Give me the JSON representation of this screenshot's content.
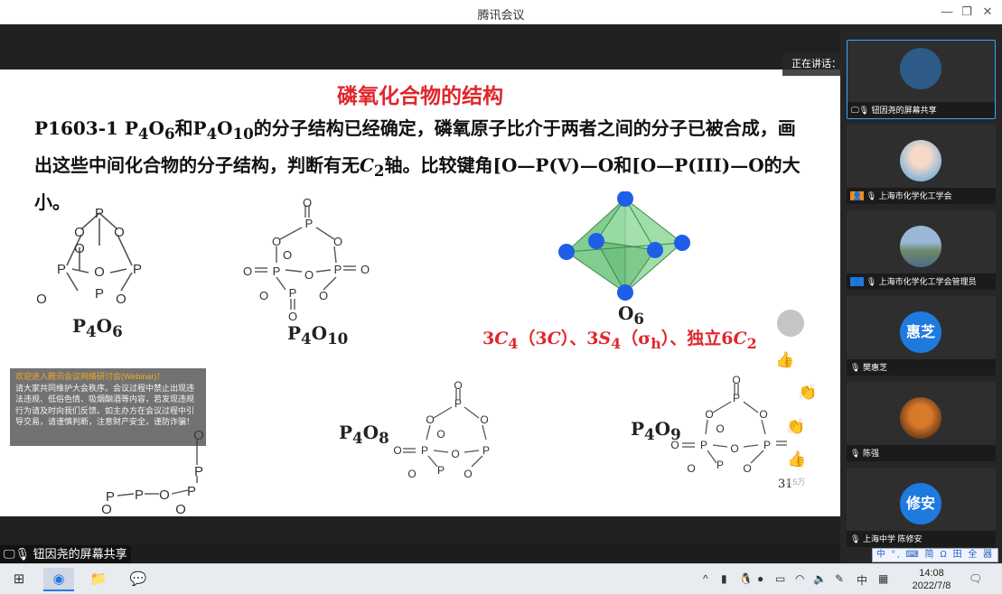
{
  "window": {
    "title": "腾讯会议"
  },
  "slide": {
    "title": "磷氧化合物的结构",
    "problem_parts": [
      "P1603-1 P",
      "4",
      "O",
      "6",
      "和P",
      "4",
      "O",
      "10",
      "的分子结构已经确定，磷氧原子比介于两者之间的分子已被合成，画出这些中间化合物的分子结构，判断有无",
      "C",
      "2",
      "轴。比较键角[O—P(V)—O和[O—P(III)—O的大小。"
    ],
    "formulas": {
      "p4o6": [
        "P",
        "4",
        "O",
        "6"
      ],
      "p4o10": [
        "P",
        "4",
        "O",
        "10"
      ],
      "p4o8": [
        "P",
        "4",
        "O",
        "8"
      ],
      "p4o9": [
        "P",
        "4",
        "O",
        "9"
      ],
      "o6": [
        "O",
        "6"
      ]
    },
    "atom_labels": {
      "phosphorus": "P",
      "oxygen": "O"
    },
    "symmetry_parts": [
      "3",
      "C",
      "4",
      "（3",
      "C",
      "）、3",
      "S",
      "4",
      "（σ",
      "h",
      "）、独立6",
      "C",
      "2"
    ],
    "page_number": "31"
  },
  "speaker": {
    "label": "正在讲话：钮因尧;"
  },
  "notice": {
    "title": "欢迎进入腾讯会议网络研讨会(Webinar)！",
    "body": "请大家共同维护大会秩序。会议过程中禁止出现违法违规、低俗色情、吸烟酗酒等内容，若发现违规行为请及时向我们反馈。如主办方在会议过程中引导交易，请谨慎判断，注意财产安全，谨防诈骗！"
  },
  "reactions": {
    "count": "3.5万"
  },
  "share_label": "钮因尧的屏幕共享",
  "participants": [
    {
      "name": "钮因尧的屏幕共享",
      "type": "screen"
    },
    {
      "name": "上海市化学化工学会",
      "type": "photo"
    },
    {
      "name": "上海市化学化工学会管理员",
      "type": "photo"
    },
    {
      "name": "樊惠芝",
      "type": "text",
      "avatar_text": "惠芝"
    },
    {
      "name": "陈强",
      "type": "photo"
    },
    {
      "name": "上海中学 陈修安",
      "type": "text",
      "avatar_text": "修安"
    }
  ],
  "ime": {
    "text": "中 °, ⌨ 简 Ω 田 全 器"
  },
  "taskbar": {
    "tray_lang": "中",
    "time": "14:08",
    "date": "2022/7/8"
  },
  "colors": {
    "accent": "#e0262b",
    "atom_blue": "#1f5fe8",
    "octahedron": "#7ccf8a"
  }
}
